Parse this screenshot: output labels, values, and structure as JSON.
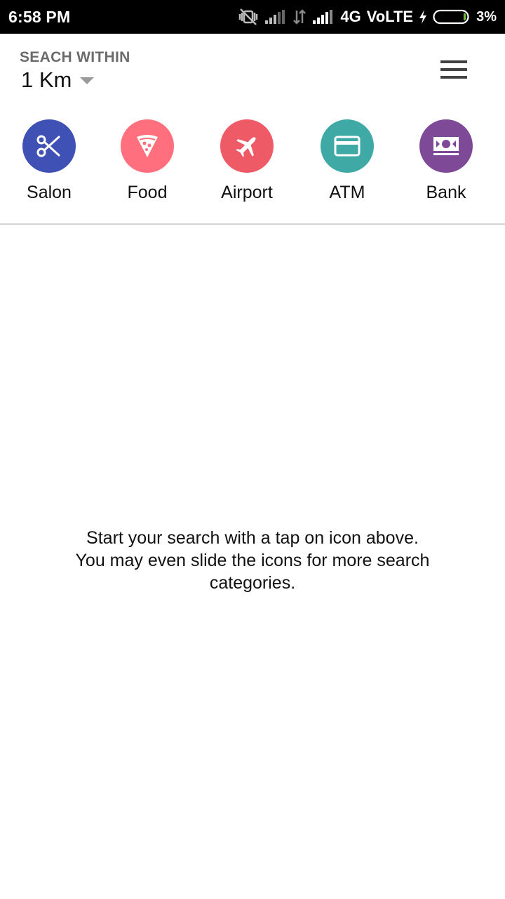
{
  "status_bar": {
    "time": "6:58 PM",
    "network": "4G",
    "volte": "VoLTE",
    "battery_percent": "3%"
  },
  "header": {
    "search_within_label": "SEACH WITHIN",
    "radius_value": "1 Km"
  },
  "categories": [
    {
      "label": "Salon",
      "icon": "scissors-icon",
      "color": "#3F51B5"
    },
    {
      "label": "Food",
      "icon": "pizza-icon",
      "color": "#FF6F7D"
    },
    {
      "label": "Airport",
      "icon": "airplane-icon",
      "color": "#EE5A66"
    },
    {
      "label": "ATM",
      "icon": "credit-card-icon",
      "color": "#3FA9A5"
    },
    {
      "label": "Bank",
      "icon": "banknote-icon",
      "color": "#7E4A98"
    }
  ],
  "hint": {
    "line1": "Start your search with a tap on icon above.",
    "line2": "You may even slide the icons for more search",
    "line3": "categories."
  }
}
